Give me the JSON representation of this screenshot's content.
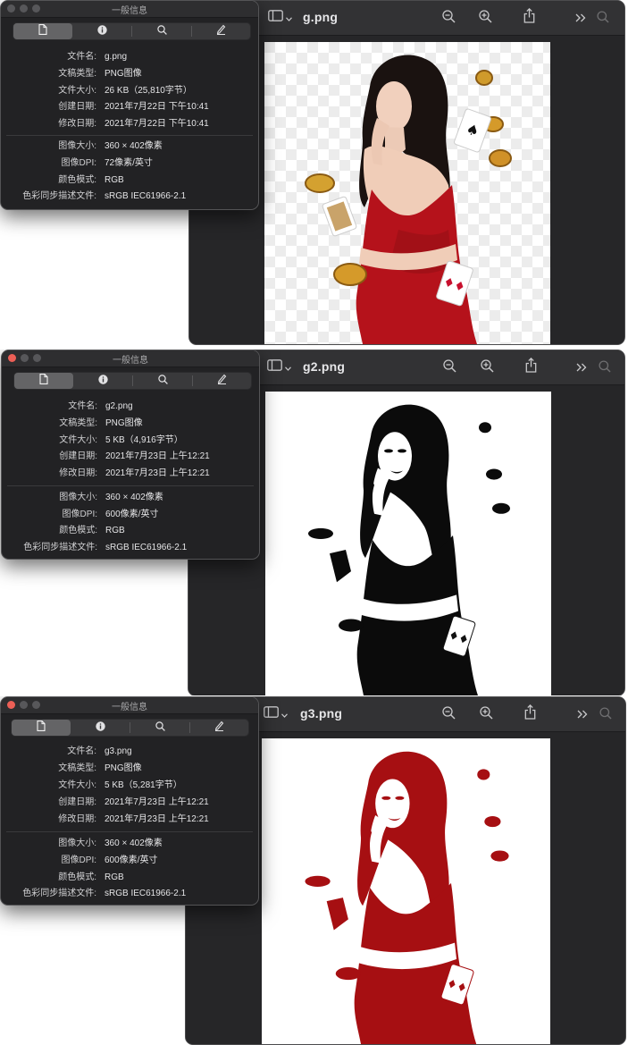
{
  "colors": {
    "dress_red": "#b5121b",
    "silhouette_black": "#0b0b0b",
    "silhouette_red": "#a60f12",
    "window_bg": "#262628",
    "toolbar_bg": "#323234",
    "info_bg": "#222224"
  },
  "icons": {
    "toolbar": [
      "sidebar-icon",
      "chevron-down-icon",
      "zoom-out-icon",
      "zoom-in-icon",
      "share-icon",
      "more-chevron-icon",
      "search-icon"
    ],
    "inspector_tabs": [
      "document-icon",
      "info-icon",
      "search-icon",
      "pencil-icon"
    ]
  },
  "panels": [
    {
      "preview": {
        "filename": "g.png",
        "image_style": "color"
      },
      "info": {
        "window_title": "一般信息",
        "rows": [
          {
            "label": "文件名:",
            "value": "g.png"
          },
          {
            "label": "文稿类型:",
            "value": "PNG图像"
          },
          {
            "label": "文件大小:",
            "value": "26 KB（25,810字节）"
          },
          {
            "label": "创建日期:",
            "value": "2021年7月22日 下午10:41"
          },
          {
            "label": "修改日期:",
            "value": "2021年7月22日 下午10:41"
          },
          {
            "label": "图像大小:",
            "value": "360 × 402像素"
          },
          {
            "label": "图像DPI:",
            "value": "72像素/英寸"
          },
          {
            "label": "颜色模式:",
            "value": "RGB"
          },
          {
            "label": "色彩同步描述文件:",
            "value": "sRGB IEC61966-2.1"
          }
        ]
      }
    },
    {
      "preview": {
        "filename": "g2.png",
        "image_style": "threshold-black"
      },
      "info": {
        "window_title": "一般信息",
        "rows": [
          {
            "label": "文件名:",
            "value": "g2.png"
          },
          {
            "label": "文稿类型:",
            "value": "PNG图像"
          },
          {
            "label": "文件大小:",
            "value": "5 KB（4,916字节）"
          },
          {
            "label": "创建日期:",
            "value": "2021年7月23日 上午12:21"
          },
          {
            "label": "修改日期:",
            "value": "2021年7月23日 上午12:21"
          },
          {
            "label": "图像大小:",
            "value": "360 × 402像素"
          },
          {
            "label": "图像DPI:",
            "value": "600像素/英寸"
          },
          {
            "label": "颜色模式:",
            "value": "RGB"
          },
          {
            "label": "色彩同步描述文件:",
            "value": "sRGB IEC61966-2.1"
          }
        ]
      }
    },
    {
      "preview": {
        "filename": "g3.png",
        "image_style": "threshold-red"
      },
      "info": {
        "window_title": "一般信息",
        "rows": [
          {
            "label": "文件名:",
            "value": "g3.png"
          },
          {
            "label": "文稿类型:",
            "value": "PNG图像"
          },
          {
            "label": "文件大小:",
            "value": "5 KB（5,281字节）"
          },
          {
            "label": "创建日期:",
            "value": "2021年7月23日 上午12:21"
          },
          {
            "label": "修改日期:",
            "value": "2021年7月23日 上午12:21"
          },
          {
            "label": "图像大小:",
            "value": "360 × 402像素"
          },
          {
            "label": "图像DPI:",
            "value": "600像素/英寸"
          },
          {
            "label": "颜色模式:",
            "value": "RGB"
          },
          {
            "label": "色彩同步描述文件:",
            "value": "sRGB IEC61966-2.1"
          }
        ]
      }
    }
  ]
}
